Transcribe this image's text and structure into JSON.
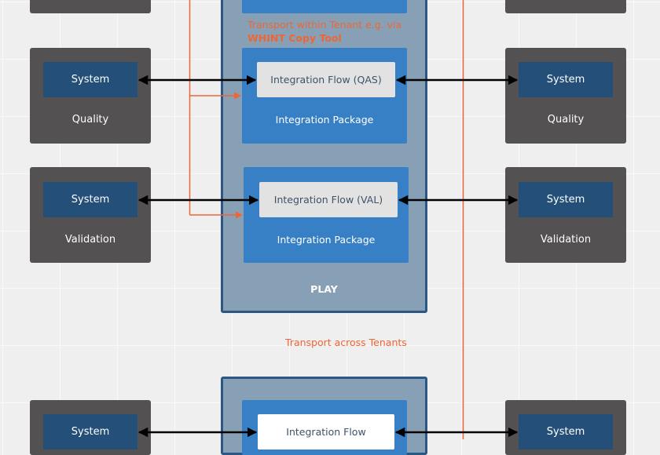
{
  "colors": {
    "canvas": "#efefef",
    "system_frame": "#535151",
    "system_box": "#234f79",
    "tenant_fill": "#87a0b6",
    "tenant_border": "#2a5783",
    "package": "#3880c6",
    "flow_box": "#e2e2e2",
    "transport_accent": "#ee6636",
    "connector": "#000000"
  },
  "left_systems": [
    {
      "system_label": "System",
      "stage_label": "Quality"
    },
    {
      "system_label": "System",
      "stage_label": "Validation"
    },
    {
      "system_label": "System"
    }
  ],
  "right_systems": [
    {
      "system_label": "System",
      "stage_label": "Quality"
    },
    {
      "system_label": "System",
      "stage_label": "Validation"
    },
    {
      "system_label": "System"
    }
  ],
  "play_tenant": {
    "label": "PLAY",
    "transport_note": {
      "text": "Transport within Tenant e.g. via",
      "bold": "WHINT Copy Tool"
    },
    "packages": [
      {
        "flow_label": "Integration Flow (QAS)",
        "package_label": "Integration Package"
      },
      {
        "flow_label": "Integration Flow (VAL)",
        "package_label": "Integration Package"
      }
    ]
  },
  "transport_across": "Transport across Tenants",
  "next_tenant": {
    "packages": [
      {
        "flow_label": "Integration Flow"
      }
    ]
  }
}
